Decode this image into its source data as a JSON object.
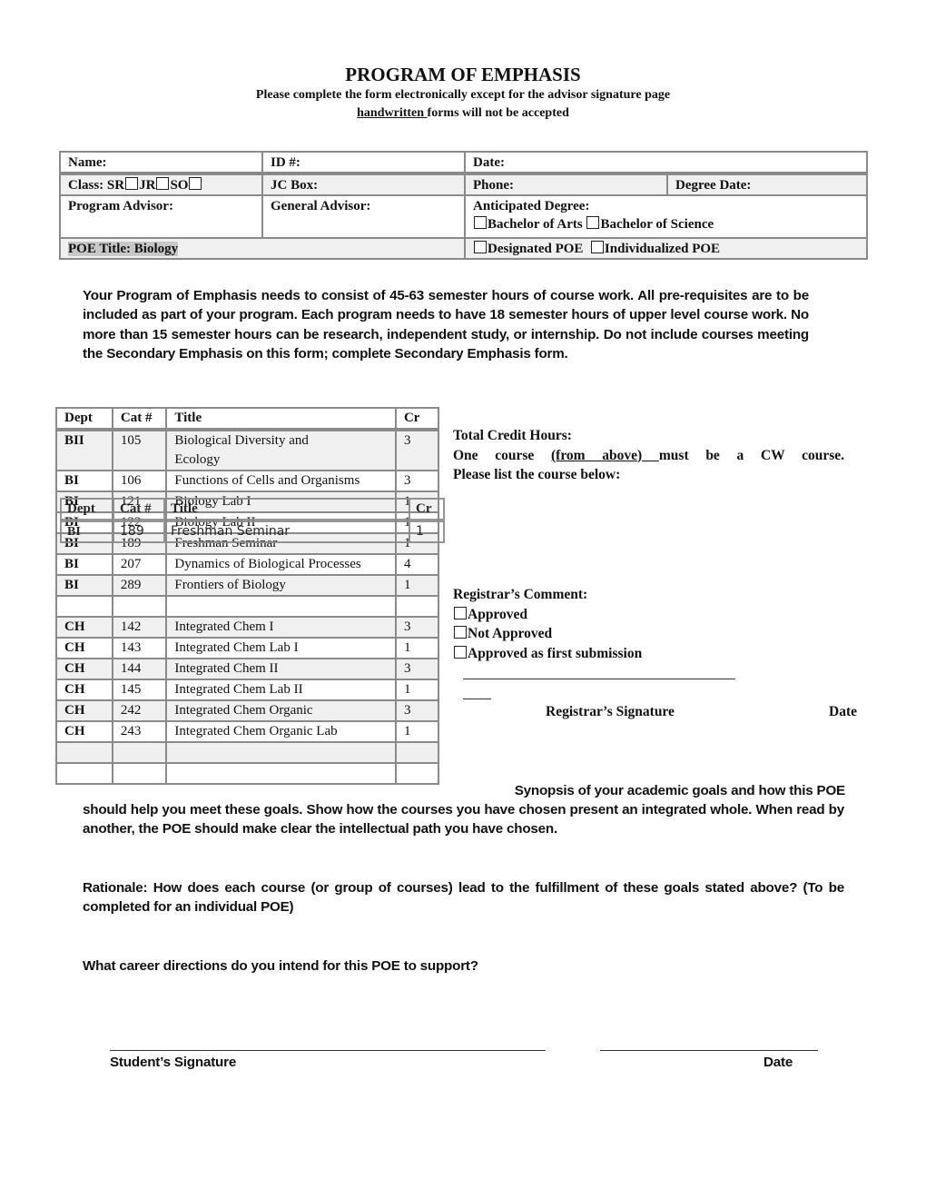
{
  "header": {
    "title": "PROGRAM OF EMPHASIS",
    "instruction": "Please complete the form electronically except for the advisor signature page",
    "warning_underlined": "handwritten ",
    "warning_rest": "forms will not be accepted"
  },
  "info_table": {
    "name_label": "Name:",
    "id_label": "ID #:",
    "date_label": "Date:",
    "class_label": "Class: ",
    "class_options": [
      "SR",
      "JR",
      "SO"
    ],
    "jc_box_label": "JC Box:",
    "phone_label": "Phone:",
    "degree_date_label": "Degree Date:",
    "program_advisor_label": "Program Advisor:",
    "general_advisor_label": "General Advisor:",
    "anticipated_degree_label": "Anticipated Degree:",
    "degree_options": [
      "Bachelor of Arts",
      "Bachelor of Science"
    ],
    "poe_title": "POE Title: Biology",
    "poe_type_options": [
      "Designated POE",
      "Individualized POE"
    ]
  },
  "requirements_text": "Your Program of Emphasis needs to consist of 45-63 semester hours of course work.  All pre-requisites are to be included as part of your program.  Each program needs to have 18 semester hours of upper level course work.  No more than 15 semester hours can be research, independent study, or internship.  Do not include courses meeting the Secondary Emphasis on this form; complete Secondary Emphasis form.",
  "courses": {
    "headers": [
      "Dept",
      "Cat #",
      "Title",
      "Cr"
    ],
    "rows": [
      {
        "dept": "BII",
        "cat": "105",
        "title": "Biological Diversity and",
        "title2": "Ecology",
        "cr": "3"
      },
      {
        "dept": "BI",
        "cat": "106",
        "title": "Functions of Cells and Organisms",
        "cr": "3"
      },
      {
        "dept": "BI",
        "cat": "121",
        "title": "Biology Lab I",
        "cr": "1"
      },
      {
        "dept": "BI",
        "cat": "122",
        "title": "Biology Lab II",
        "cr": "1"
      },
      {
        "dept": "BI",
        "cat": "189",
        "title": "Freshman Seminar",
        "cr": "1"
      },
      {
        "dept": "BI",
        "cat": "207",
        "title": "Dynamics of Biological Processes",
        "cr": "4"
      },
      {
        "dept": "BI",
        "cat": "289",
        "title": "Frontiers of Biology",
        "cr": "1"
      },
      {
        "dept": "",
        "cat": "",
        "title": "",
        "cr": ""
      },
      {
        "dept": "CH",
        "cat": "142",
        "title": "Integrated Chem I",
        "cr": "3"
      },
      {
        "dept": "CH",
        "cat": "143",
        "title": "Integrated Chem Lab I",
        "cr": "1"
      },
      {
        "dept": "CH",
        "cat": "144",
        "title": "Integrated Chem II",
        "cr": "3"
      },
      {
        "dept": "CH",
        "cat": "145",
        "title": "Integrated Chem Lab II",
        "cr": "1"
      },
      {
        "dept": "CH",
        "cat": "242",
        "title": "Integrated Chem Organic",
        "cr": "3"
      },
      {
        "dept": "CH",
        "cat": "243",
        "title": "Integrated Chem Organic Lab",
        "cr": "1"
      },
      {
        "dept": "",
        "cat": "",
        "title": "",
        "cr": ""
      },
      {
        "dept": "",
        "cat": "",
        "title": "",
        "cr": ""
      }
    ]
  },
  "overlay_table": {
    "headers": [
      "Dept",
      "Cat #",
      "Title",
      "Cr"
    ],
    "row": {
      "dept": "BI",
      "cat": "189",
      "title": "Freshman Seminar",
      "cr": "1"
    }
  },
  "credit_panel": {
    "total_label": "Total Credit Hours:",
    "cw_prefix": "One course ",
    "cw_underlined": "(from above) ",
    "cw_suffix": "must be a CW course.",
    "cw_list": "Please list the course below:"
  },
  "registrar": {
    "comment_label": "Registrar’s Comment:",
    "options": [
      "Approved",
      "Not Approved",
      "Approved as first submission"
    ],
    "signature_label": "Registrar’s Signature",
    "date_label": "Date"
  },
  "synopsis_start": "Synopsis of your academic goals and how this POE",
  "synopsis_rest": "should help you meet these goals.  Show how the courses you have chosen present an integrated whole.  When read by another, the POE should make clear the intellectual path you have chosen.",
  "rationale": "Rationale: How does each course (or group of courses) lead to the fulfillment of these goals stated above?  (To be completed for an individual POE)",
  "career": "What career directions do you intend for this POE to support?",
  "student": {
    "signature_label": "Student’s Signature",
    "date_label": "Date"
  }
}
